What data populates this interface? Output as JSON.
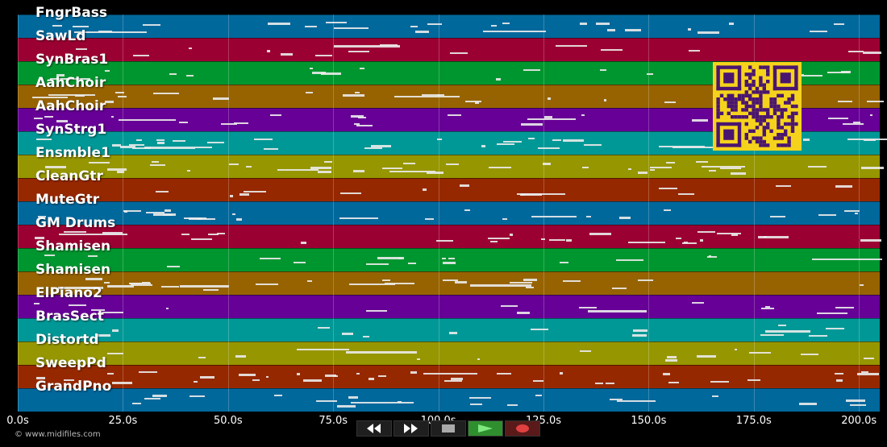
{
  "tracks": [
    {
      "label": "FngrBass",
      "color": "#01689c"
    },
    {
      "label": "SawLd",
      "color": "#9b0032"
    },
    {
      "label": "SynBras1",
      "color": "#00962f"
    },
    {
      "label": "AahChoir",
      "color": "#966300"
    },
    {
      "label": "AahChoir",
      "color": "#670096"
    },
    {
      "label": "SynStrg1",
      "color": "#009896"
    },
    {
      "label": "Ensmble1",
      "color": "#969600"
    },
    {
      "label": "CleanGtr",
      "color": "#962800"
    },
    {
      "label": "MuteGtr",
      "color": "#01689c"
    },
    {
      "label": "GM Drums",
      "color": "#9b0032"
    },
    {
      "label": "Shamisen",
      "color": "#00962f"
    },
    {
      "label": "Shamisen",
      "color": "#966300"
    },
    {
      "label": "ElPiano2",
      "color": "#670096"
    },
    {
      "label": "BrasSect",
      "color": "#009896"
    },
    {
      "label": "Distortd",
      "color": "#969600"
    },
    {
      "label": "SweepPd",
      "color": "#962800"
    },
    {
      "label": "GrandPno",
      "color": "#01689c"
    }
  ],
  "axis": {
    "ticks": [
      "0.0s",
      "25.0s",
      "50.0s",
      "75.0s",
      "100.0s",
      "125.0s",
      "150.0s",
      "175.0s",
      "200.0s"
    ]
  },
  "credit": "© www.midifiles.com",
  "controls": [
    {
      "name": "rewind-button",
      "icon": "rewind-icon"
    },
    {
      "name": "fast-forward-button",
      "icon": "fast-forward-icon"
    },
    {
      "name": "stop-button",
      "icon": "stop-icon"
    },
    {
      "name": "play-button",
      "icon": "play-icon",
      "color": "#2f8f2f"
    },
    {
      "name": "record-button",
      "icon": "record-icon",
      "color": "#c0392b"
    }
  ]
}
